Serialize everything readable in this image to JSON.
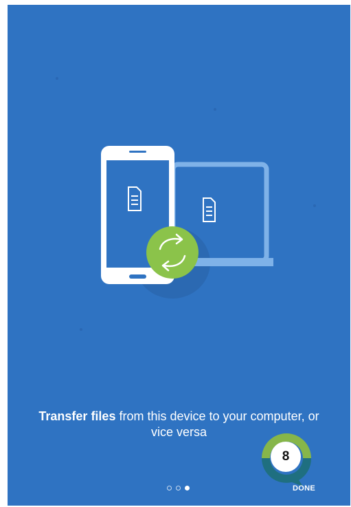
{
  "slide": {
    "caption_bold": "Transfer files",
    "caption_rest": " from this device to your computer, or vice versa",
    "illustration": {
      "phone_icon": "phone-device-icon",
      "laptop_icon": "laptop-device-icon",
      "document_icon": "document-icon",
      "sync_icon": "sync-arrows-icon"
    }
  },
  "pager": {
    "total": 3,
    "active_index": 3
  },
  "actions": {
    "done_label": "DONE"
  },
  "badge": {
    "value": "8"
  },
  "colors": {
    "background": "#2f73c2",
    "sync_green": "#8bc34a",
    "laptop_light_blue": "#7fb2e8",
    "badge_teal": "#1f6f80",
    "badge_green": "#86b64a"
  }
}
